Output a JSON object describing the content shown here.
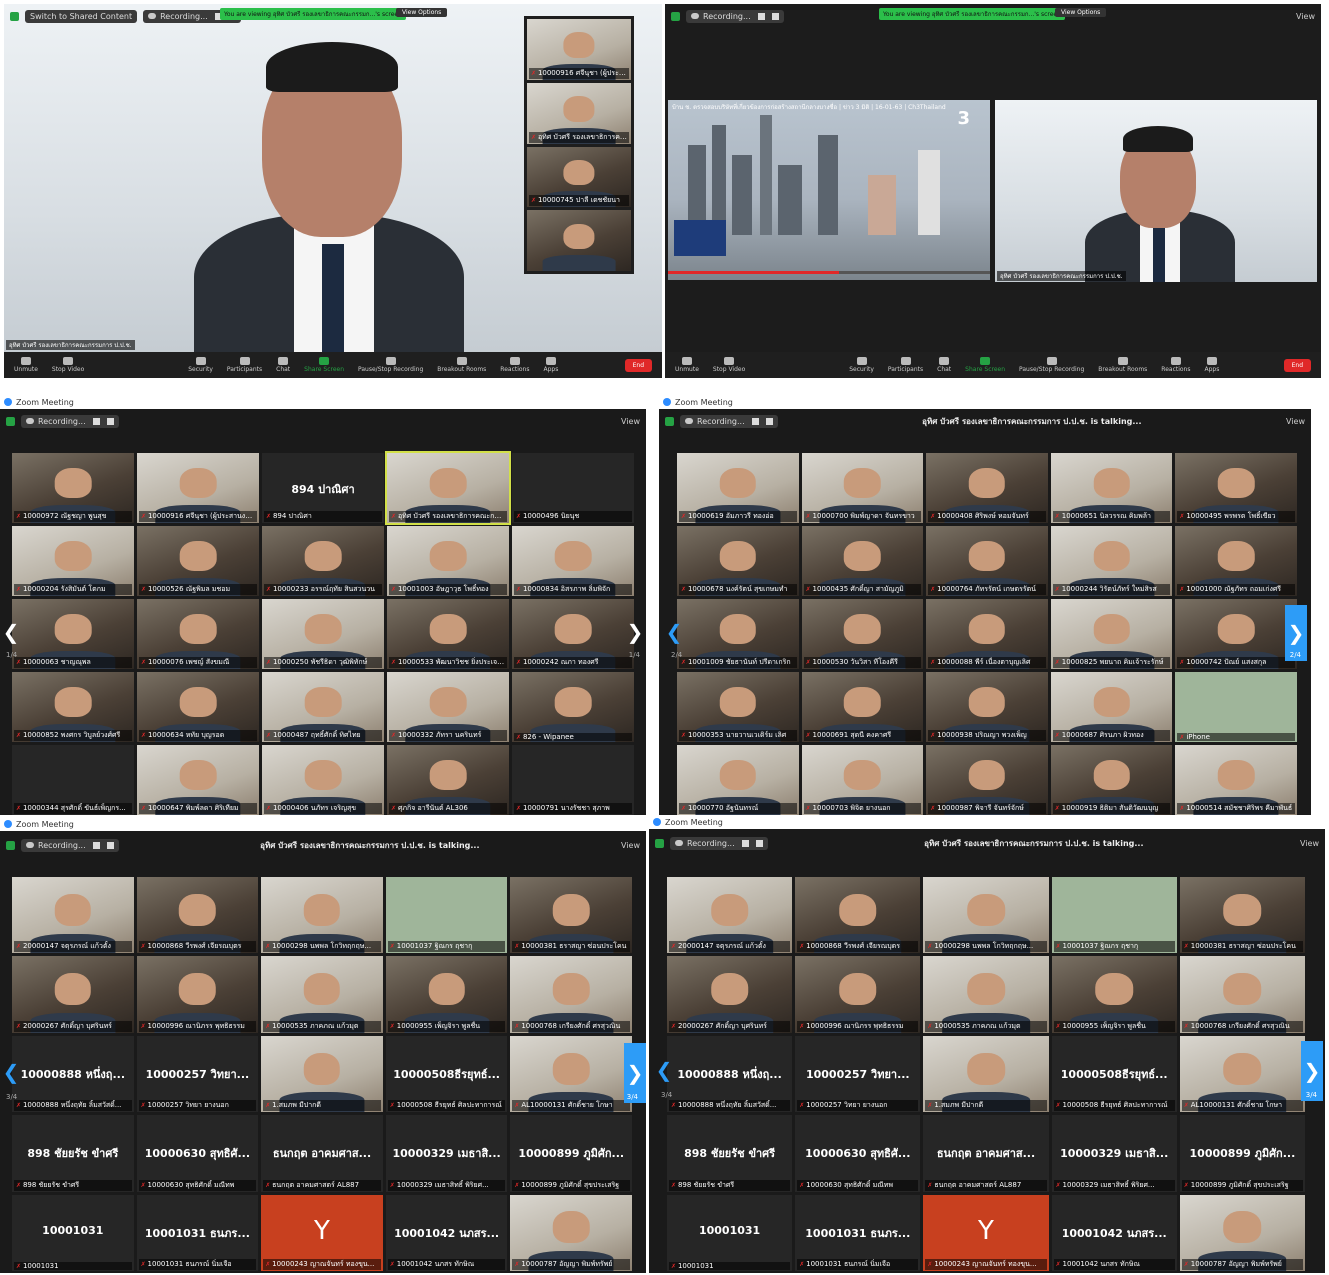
{
  "p1": {
    "banner": "You are viewing อุทิศ บัวศรี รองเลขาธิการคณะกรรมก...'s screen",
    "view_options": "View Options",
    "switch_shared": "Switch to Shared Content",
    "recording": "Recording...",
    "speaker_label": "อุทิศ บัวศรี รองเลขาธิการคณะกรรมการ ป.ป.ช.",
    "strip": [
      "10000916 ศจีนุชา (ผู้ประสานงาน)",
      "อุทิศ บัวศรี รองเลขาธิการคณะกรรมการ...",
      "10000745 ปาลี เดชชัยนา",
      ""
    ],
    "toolbar": [
      "Unmute",
      "Stop Video",
      "Security",
      "Participants",
      "Chat",
      "Share Screen",
      "Pause/Stop Recording",
      "Breakout Rooms",
      "Reactions",
      "Apps"
    ],
    "participants_count": "92",
    "end": "End"
  },
  "p2": {
    "banner": "You are viewing อุทิศ บัวศรี รองเลขาธิการคณะกรรมก...'s screen",
    "view_options": "View Options",
    "recording": "Recording...",
    "view": "View",
    "video_title": "บ้าน ช. ตรวจสอบบริษัทที่เกี่ยวข้องการก่อสร้างสถานีกลางบางซื่อ | ข่าว 3 มิติ | 16-01-63 | Ch3Thailand",
    "channel": "3",
    "speaker_label": "อุทิศ บัวศรี รองเลขาธิการคณะกรรมการ ป.ป.ช.",
    "toolbar": [
      "Unmute",
      "Stop Video",
      "Security",
      "Participants",
      "Chat",
      "Share Screen",
      "Pause/Stop Recording",
      "Breakout Rooms",
      "Reactions",
      "Apps"
    ],
    "participants_count": "95",
    "end": "End"
  },
  "p3": {
    "window": "Zoom Meeting",
    "recording": "Recording...",
    "view": "View",
    "page_left": "1/4",
    "page_right": "1/4",
    "tiles": [
      {
        "n": "10000972 ณัฐชญา พูนสุข",
        "t": "cam"
      },
      {
        "n": "10000916 ศจีนุชา (ผู้ประสานงาน)",
        "t": "w"
      },
      {
        "n": "894 ปาณิศา",
        "t": "text",
        "big": "894 ปาณิศา"
      },
      {
        "n": "อุทิศ บัวศรี รองเลขาธิการคณะกรรม...",
        "t": "active"
      },
      {
        "n": "10000496 นิยนุช",
        "t": "dark"
      },
      {
        "n": "10000204 รังสิมันต์ โตกม",
        "t": "w"
      },
      {
        "n": "10000526 ณัฐพิมล มชอม",
        "t": "cam"
      },
      {
        "n": "10000233 อรรณ์ฤทัย สินสวนวน",
        "t": "cam"
      },
      {
        "n": "10001003 อัษฎาวุธ โพธิ์ทอง",
        "t": "w"
      },
      {
        "n": "10000834 อิสรภาพ ลิ่มพิจัก",
        "t": "w"
      },
      {
        "n": "10000063 ชาญณุพล",
        "t": "cam"
      },
      {
        "n": "10000076 เพชญ์ สังขมณี",
        "t": "cam"
      },
      {
        "n": "10000250 พัชรีธิดา วุฒิพิทักษ์",
        "t": "w"
      },
      {
        "n": "10000533 พัฒนาวิชช ยิ่งประเจริญ",
        "t": "cam"
      },
      {
        "n": "10000242 ณภา ทองศรี",
        "t": "cam"
      },
      {
        "n": "10000852 พงศกร วิบูลย์วงศ์ศรี",
        "t": "cam"
      },
      {
        "n": "10000634 หทัย บุญรอด",
        "t": "cam"
      },
      {
        "n": "10000487 ฤทธิ์ศักดิ์ ทิศไทย",
        "t": "w"
      },
      {
        "n": "10000332 ภัทรา นครินทร์",
        "t": "w"
      },
      {
        "n": "826 - Wipanee",
        "t": "cam"
      },
      {
        "n": "10000344 สุรศักดิ์ ขันธ์เพ็ญกร...",
        "t": "dark"
      },
      {
        "n": "10000647 พิมพ์ลดา ศิริเทียม",
        "t": "w"
      },
      {
        "n": "10000406 นภัทร เจริญสุข",
        "t": "w"
      },
      {
        "n": "ศุภกิจ อารีนันต์ AL306",
        "t": "cam"
      },
      {
        "n": "10000791 นางรัชชา สุภาพ",
        "t": "dark"
      }
    ]
  },
  "p4": {
    "window": "Zoom Meeting",
    "recording": "Recording...",
    "talking": "อุทิศ บัวศรี รองเลขาธิการคณะกรรมการ ป.ป.ช. is talking...",
    "view": "View",
    "page_left": "2/4",
    "page_right": "2/4",
    "tiles": [
      {
        "n": "10000619 อัมภาวรี ทองอ่อ",
        "t": "w"
      },
      {
        "n": "10000700 พิมพ์ญาดา จันทรขาว",
        "t": "w"
      },
      {
        "n": "10000408 ศิริพงษ์ หอมจันทร์",
        "t": "cam"
      },
      {
        "n": "10000651 นิลวรรณ คิมพล้า",
        "t": "w"
      },
      {
        "n": "10000495 พรพรต โพธิ์เขียว",
        "t": "cam"
      },
      {
        "n": "10000678 นงค์รัตน์ สุขเกษมทำ",
        "t": "cam"
      },
      {
        "n": "10000435 ศักดิ์ญา สามัญภูมิ",
        "t": "cam"
      },
      {
        "n": "10000764 ภัทรรัตน์ เกษตรรัตน์",
        "t": "cam"
      },
      {
        "n": "10000244 วิรัตน์ภัทร์ ใหม่สิรส",
        "t": "w"
      },
      {
        "n": "10001000 ณัฐภัทร ถอมเก่งศรี",
        "t": "cam"
      },
      {
        "n": "10001009 ชัยธานันท์ ปรีดาเกริก",
        "t": "cam"
      },
      {
        "n": "10000530 วันวิสา ทีโองคีรี",
        "t": "cam"
      },
      {
        "n": "10000088 พีร์ เนื่องตาบุญเลิศ",
        "t": "cam"
      },
      {
        "n": "10000825 พยนาถ คิมเจ้าระรักษ์",
        "t": "w"
      },
      {
        "n": "10000742 ปัณย์ แสงสกุล",
        "t": "cam"
      },
      {
        "n": "10000353 นายวานเวเดิร์ม เลิศ",
        "t": "cam"
      },
      {
        "n": "10000691 สุดนี คงคาศรี",
        "t": "cam"
      },
      {
        "n": "10000938 ปริณญา พวงเพ็ญ",
        "t": "cam"
      },
      {
        "n": "10000687 ศิรนภา ผิวทอง",
        "t": "w"
      },
      {
        "n": "iPhone",
        "t": "g"
      },
      {
        "n": "10000770 อัฐนันทรณ์",
        "t": "w"
      },
      {
        "n": "10000703 พิจิต ยางนอก",
        "t": "w"
      },
      {
        "n": "10000987 พิจารี จันทร์จักษ์",
        "t": "cam"
      },
      {
        "n": "10000919 ธิติมา สันติวัฒนบุญ",
        "t": "cam"
      },
      {
        "n": "10000514 สมัชชาศิริพร คีมาพันธ์",
        "t": "w"
      }
    ]
  },
  "p5": {
    "window": "Zoom Meeting",
    "recording": "Recording...",
    "talking": "อุทิศ บัวศรี รองเลขาธิการคณะกรรมการ ป.ป.ช. is talking...",
    "view": "View",
    "page_left": "3/4",
    "page_right": "3/4",
    "tiles": [
      {
        "n": "20000147 จตุรภรณ์ แก้วตั้ง",
        "t": "w"
      },
      {
        "n": "10000868 วีรพงศ์ เจียรณบุตร",
        "t": "cam"
      },
      {
        "n": "10000298 นพพล โกวิทฤกฤษ...",
        "t": "w"
      },
      {
        "n": "10001037 ฐิณกร ฤชากุ",
        "t": "g"
      },
      {
        "n": "10000381 ธราสญา ซ่อนประโคน",
        "t": "cam"
      },
      {
        "n": "20000267 ศักดิ์ญา บุศรินทร์",
        "t": "cam"
      },
      {
        "n": "10000996 ณานิภรร พุทธิธรรม",
        "t": "cam"
      },
      {
        "n": "10000535 ภาคภณ แก้วมุต",
        "t": "w"
      },
      {
        "n": "10000955 เพ็ญจิรา พูลชื่น",
        "t": "cam"
      },
      {
        "n": "10000768 เกรียงศักดิ์ ศรสุวณิน",
        "t": "w"
      },
      {
        "n": "10000888 หนึ่งฤทัย ลิ้มสวัสดิ์...",
        "t": "text",
        "big": "10000888 หนึ่งฤ..."
      },
      {
        "n": "10000257 วิทยา ยางนอก",
        "t": "text",
        "big": "10000257 วิทยา..."
      },
      {
        "n": "1.สมภพ มีปากดี",
        "t": "w"
      },
      {
        "n": "10000508 ธีรยุทธ์ ศิลปะทาการณ์",
        "t": "text",
        "big": "10000508ธีรยุทธ์..."
      },
      {
        "n": "AL10000131 ศักดิ์ชาย โกษา",
        "t": "w"
      },
      {
        "n": "898 ชัยยรัช ขำศรี",
        "t": "text",
        "big": "898 ชัยยรัช ขำศรี"
      },
      {
        "n": "10000630 สุทธิศักดิ์ มณีทพ",
        "t": "text",
        "big": "10000630 สุทธิศั..."
      },
      {
        "n": "ธนกฤต อาคมศาสตร์ AL887",
        "t": "text",
        "big": "ธนกฤต อาคมศาส..."
      },
      {
        "n": "10000329 เมธาสิทธิ์ พิริยศ...",
        "t": "text",
        "big": "10000329 เมธาสิ..."
      },
      {
        "n": "10000899 ภูมิศักดิ์ สุขประเสริฐ",
        "t": "text",
        "big": "10000899 ภูมิศัก..."
      },
      {
        "n": "10001031",
        "t": "text",
        "big": "10001031"
      },
      {
        "n": "10001031 ธนภรณ์ นิ่มเจือ",
        "t": "text",
        "big": "10001031 ธนภร..."
      },
      {
        "n": "10000243 ญาณจันทร์ ทองขุน...",
        "t": "y",
        "big": "Y"
      },
      {
        "n": "10001042 นภสร ทักษิณ",
        "t": "text",
        "big": "10001042 นภสร..."
      },
      {
        "n": "10000787 อัญญา พิมพ์ทรัพย์",
        "t": "w"
      }
    ]
  },
  "p6": {
    "window": "Zoom Meeting",
    "recording": "Recording...",
    "talking": "อุทิศ บัวศรี รองเลขาธิการคณะกรรมการ ป.ป.ช. is talking...",
    "view": "View",
    "page_left": "3/4",
    "page_right": "3/4",
    "tiles": [
      {
        "n": "20000147 จตุรภรณ์ แก้วตั้ง",
        "t": "w"
      },
      {
        "n": "10000868 วีรพงศ์ เจียรณบุตร",
        "t": "cam"
      },
      {
        "n": "10000298 นพพล โกวิทฤกฤษ...",
        "t": "w"
      },
      {
        "n": "10001037 ฐิณกร ฤชากุ",
        "t": "g"
      },
      {
        "n": "10000381 ธราสญา ซ่อนประโคน",
        "t": "cam"
      },
      {
        "n": "20000267 ศักดิ์ญา บุศรินทร์",
        "t": "cam"
      },
      {
        "n": "10000996 ณานิภรร พุทธิธรรม",
        "t": "cam"
      },
      {
        "n": "10000535 ภาคภณ แก้วมุต",
        "t": "w"
      },
      {
        "n": "10000955 เพ็ญจิรา พูลชื่น",
        "t": "cam"
      },
      {
        "n": "10000768 เกรียงศักดิ์ ศรสุวณิน",
        "t": "w"
      },
      {
        "n": "10000888 หนึ่งฤทัย ลิ้มสวัสดิ์...",
        "t": "text",
        "big": "10000888 หนึ่งฤ..."
      },
      {
        "n": "10000257 วิทยา ยางนอก",
        "t": "text",
        "big": "10000257 วิทยา..."
      },
      {
        "n": "1.สมภพ มีปากดี",
        "t": "w"
      },
      {
        "n": "10000508 ธีรยุทธ์ ศิลปะทาการณ์",
        "t": "text",
        "big": "10000508ธีรยุทธ์..."
      },
      {
        "n": "AL10000131 ศักดิ์ชาย โกษา",
        "t": "w"
      },
      {
        "n": "898 ชัยยรัช ขำศรี",
        "t": "text",
        "big": "898 ชัยยรัช ขำศรี"
      },
      {
        "n": "10000630 สุทธิศักดิ์ มณีทพ",
        "t": "text",
        "big": "10000630 สุทธิศั..."
      },
      {
        "n": "ธนกฤต อาคมศาสตร์ AL887",
        "t": "text",
        "big": "ธนกฤต อาคมศาส..."
      },
      {
        "n": "10000329 เมธาสิทธิ์ พิริยศ...",
        "t": "text",
        "big": "10000329 เมธาสิ..."
      },
      {
        "n": "10000899 ภูมิศักดิ์ สุขประเสริฐ",
        "t": "text",
        "big": "10000899 ภูมิศัก..."
      },
      {
        "n": "10001031",
        "t": "text",
        "big": "10001031"
      },
      {
        "n": "10001031 ธนภรณ์ นิ่มเจือ",
        "t": "text",
        "big": "10001031 ธนภร..."
      },
      {
        "n": "10000243 ญาณจันทร์ ทองขุน...",
        "t": "y",
        "big": "Y"
      },
      {
        "n": "10001042 นภสร ทักษิณ",
        "t": "text",
        "big": "10001042 นภสร..."
      },
      {
        "n": "10000787 อัญญา พิมพ์ทรัพย์",
        "t": "w"
      }
    ]
  }
}
